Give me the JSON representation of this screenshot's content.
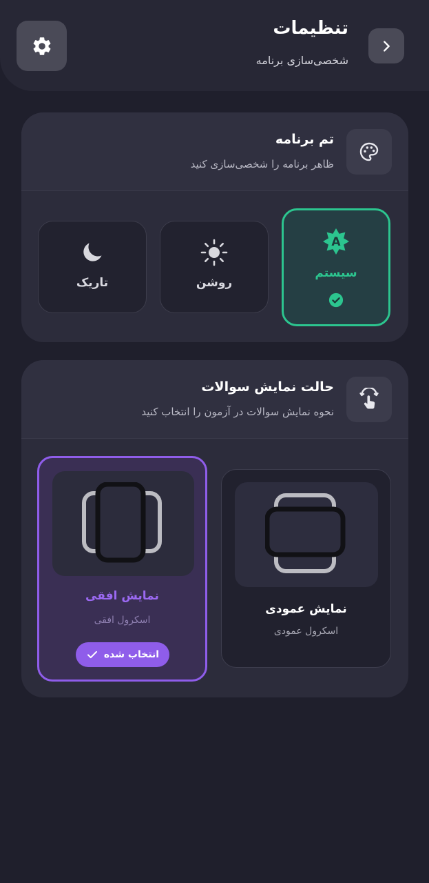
{
  "header": {
    "title": "تنظیمات",
    "subtitle": "شخصی‌سازی برنامه",
    "icons": {
      "back": "chevron-right-icon",
      "settings": "gear-icon"
    }
  },
  "theme_section": {
    "title": "تم برنامه",
    "subtitle": "ظاهر برنامه را شخصی‌سازی کنید",
    "icon": "palette-icon",
    "options": [
      {
        "label": "سیستم",
        "icon": "auto-theme-icon",
        "selected": true
      },
      {
        "label": "روشن",
        "icon": "sun-icon",
        "selected": false
      },
      {
        "label": "تاریک",
        "icon": "moon-icon",
        "selected": false
      }
    ]
  },
  "display_section": {
    "title": "حالت نمایش سوالات",
    "subtitle": "نحوه نمایش سوالات در آزمون را انتخاب کنید",
    "icon": "swipe-touch-icon",
    "options": [
      {
        "label": "نمایش عمودی",
        "sub": "اسکرول عمودی",
        "selected": false
      },
      {
        "label": "نمایش افقی",
        "sub": "اسکرول افقی",
        "selected": true,
        "badge": "انتخاب شده"
      }
    ]
  },
  "colors": {
    "background": "#1f1f2c",
    "card": "#2c2c3b",
    "accent_green": "#2cc58f",
    "accent_purple": "#8f5dea"
  }
}
